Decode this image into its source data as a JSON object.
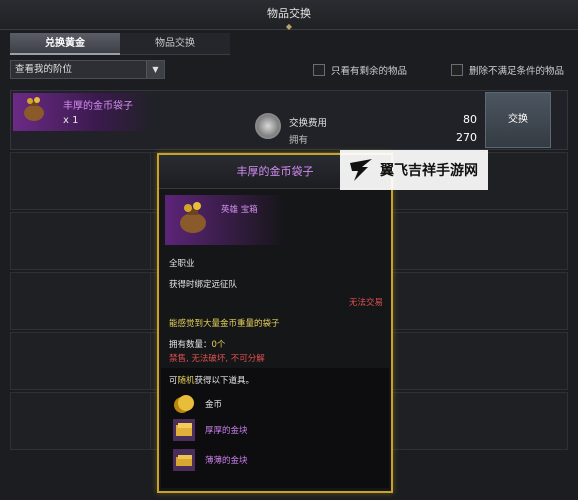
{
  "window": {
    "title": "物品交换"
  },
  "tabs": [
    {
      "label": "兑换黄金",
      "active": true
    },
    {
      "label": "物品交换",
      "active": false
    }
  ],
  "filter": {
    "select_value": "查看我的阶位",
    "check_remaining_label": "只看有剩余的物品",
    "check_exclude_label": "删除不满足条件的物品"
  },
  "item": {
    "name": "丰厚的金币袋子",
    "quantity": "x 1",
    "cost_label": "交换费用",
    "cost_value": "80",
    "owned_label": "拥有",
    "owned_value": "270",
    "exchange_label": "交换"
  },
  "tooltip": {
    "title": "丰厚的金币袋子",
    "grade": "英雄 宝箱",
    "class": "全职业",
    "bind": "获得时绑定远征队",
    "trade": "无法交易",
    "desc": "能感觉到大量金币重量的袋子",
    "owned_label": "拥有数量：",
    "owned_value": "0个",
    "restriction": "禁售, 无法破坏, 不可分解",
    "random_prefix": "可",
    "random_highlight": "随机",
    "random_suffix": "获得以下道具。",
    "rewards": [
      {
        "label": "金币",
        "color": "#e6e6e6"
      },
      {
        "label": "厚厚的金块",
        "color": "#c77fe8"
      },
      {
        "label": "薄薄的金块",
        "color": "#c77fe8"
      }
    ]
  },
  "watermark": {
    "text": "翼飞吉祥手游网"
  },
  "colors": {
    "accent_gold": "#c9a227",
    "hero_purple": "#d48ef0",
    "warning_red": "#e05050"
  }
}
